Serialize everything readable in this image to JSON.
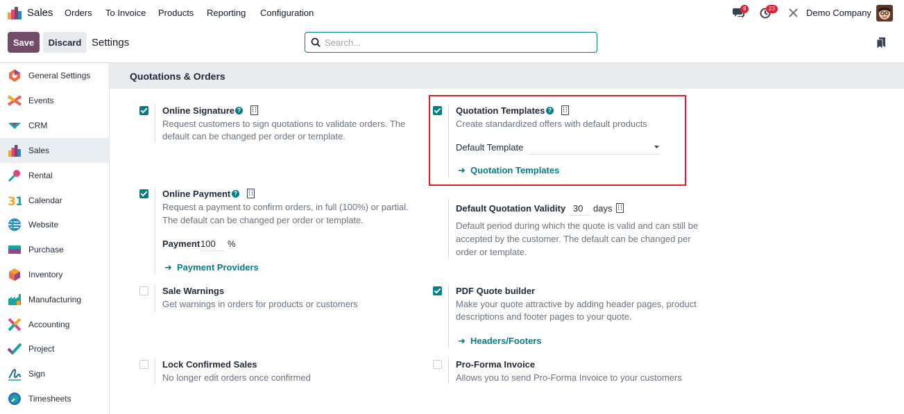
{
  "navbar": {
    "app_name": "Sales",
    "menus": [
      "Orders",
      "To Invoice",
      "Products",
      "Reporting",
      "Configuration"
    ],
    "messages_count": "8",
    "activities_count": "23",
    "company": "Demo Company"
  },
  "control_panel": {
    "save_label": "Save",
    "discard_label": "Discard",
    "breadcrumb": "Settings",
    "search_placeholder": "Search..."
  },
  "sidebar": {
    "items": [
      {
        "label": "General Settings",
        "icon": "general-settings-icon",
        "color": "#e46f4a"
      },
      {
        "label": "Events",
        "icon": "events-icon",
        "color": "#f06050"
      },
      {
        "label": "CRM",
        "icon": "crm-icon",
        "color": "#1aa3a3"
      },
      {
        "label": "Sales",
        "icon": "sales-icon",
        "color": "#f5a623"
      },
      {
        "label": "Rental",
        "icon": "rental-icon",
        "color": "#e0457b"
      },
      {
        "label": "Calendar",
        "icon": "calendar-icon",
        "color": "#f5a623"
      },
      {
        "label": "Website",
        "icon": "website-icon",
        "color": "#2a88c9"
      },
      {
        "label": "Purchase",
        "icon": "purchase-icon",
        "color": "#8e4a8b"
      },
      {
        "label": "Inventory",
        "icon": "inventory-icon",
        "color": "#f0a030"
      },
      {
        "label": "Manufacturing",
        "icon": "manufacturing-icon",
        "color": "#1aa3a3"
      },
      {
        "label": "Accounting",
        "icon": "accounting-icon",
        "color": "#e0457b"
      },
      {
        "label": "Project",
        "icon": "project-icon",
        "color": "#1aa3a3"
      },
      {
        "label": "Sign",
        "icon": "sign-icon",
        "color": "#1a6f8a"
      },
      {
        "label": "Timesheets",
        "icon": "timesheets-icon",
        "color": "#2a6fb5"
      }
    ],
    "active_index": 3
  },
  "section": {
    "title": "Quotations & Orders"
  },
  "settings": {
    "online_signature": {
      "title": "Online Signature",
      "desc_line1": "Request customers to sign quotations to validate orders. The",
      "desc_line2": "default can be changed per order or template.",
      "checked": true
    },
    "quotation_templates": {
      "title": "Quotation Templates",
      "desc": "Create standardized offers with default products",
      "field_label": "Default Template",
      "field_value": "",
      "link": "Quotation Templates",
      "checked": true
    },
    "online_payment": {
      "title": "Online Payment",
      "desc_line1": "Request a payment to confirm orders, in full (100%) or partial.",
      "desc_line2": "The default can be changed per order or template.",
      "payment_label": "Payment",
      "payment_value": "100",
      "payment_unit": "%",
      "link": "Payment Providers",
      "checked": true
    },
    "quotation_validity": {
      "title": "Default Quotation Validity",
      "value": "30",
      "unit": "days",
      "desc_line1": "Default period during which the quote is valid and can still be",
      "desc_line2": "accepted by the customer. The default can be changed per",
      "desc_line3": "order or template."
    },
    "sale_warnings": {
      "title": "Sale Warnings",
      "desc": "Get warnings in orders for products or customers",
      "checked": false
    },
    "pdf_quote_builder": {
      "title": "PDF Quote builder",
      "desc_line1": "Make your quote attractive by adding header pages, product",
      "desc_line2": "descriptions and footer pages to your quote.",
      "link": "Headers/Footers",
      "checked": true
    },
    "lock_confirmed_sales": {
      "title": "Lock Confirmed Sales",
      "desc": "No longer edit orders once confirmed",
      "checked": false
    },
    "pro_forma_invoice": {
      "title": "Pro-Forma Invoice",
      "desc": "Allows you to send Pro-Forma Invoice to your customers",
      "checked": false
    }
  },
  "help_glyph": "?",
  "link_arrow": "➜"
}
